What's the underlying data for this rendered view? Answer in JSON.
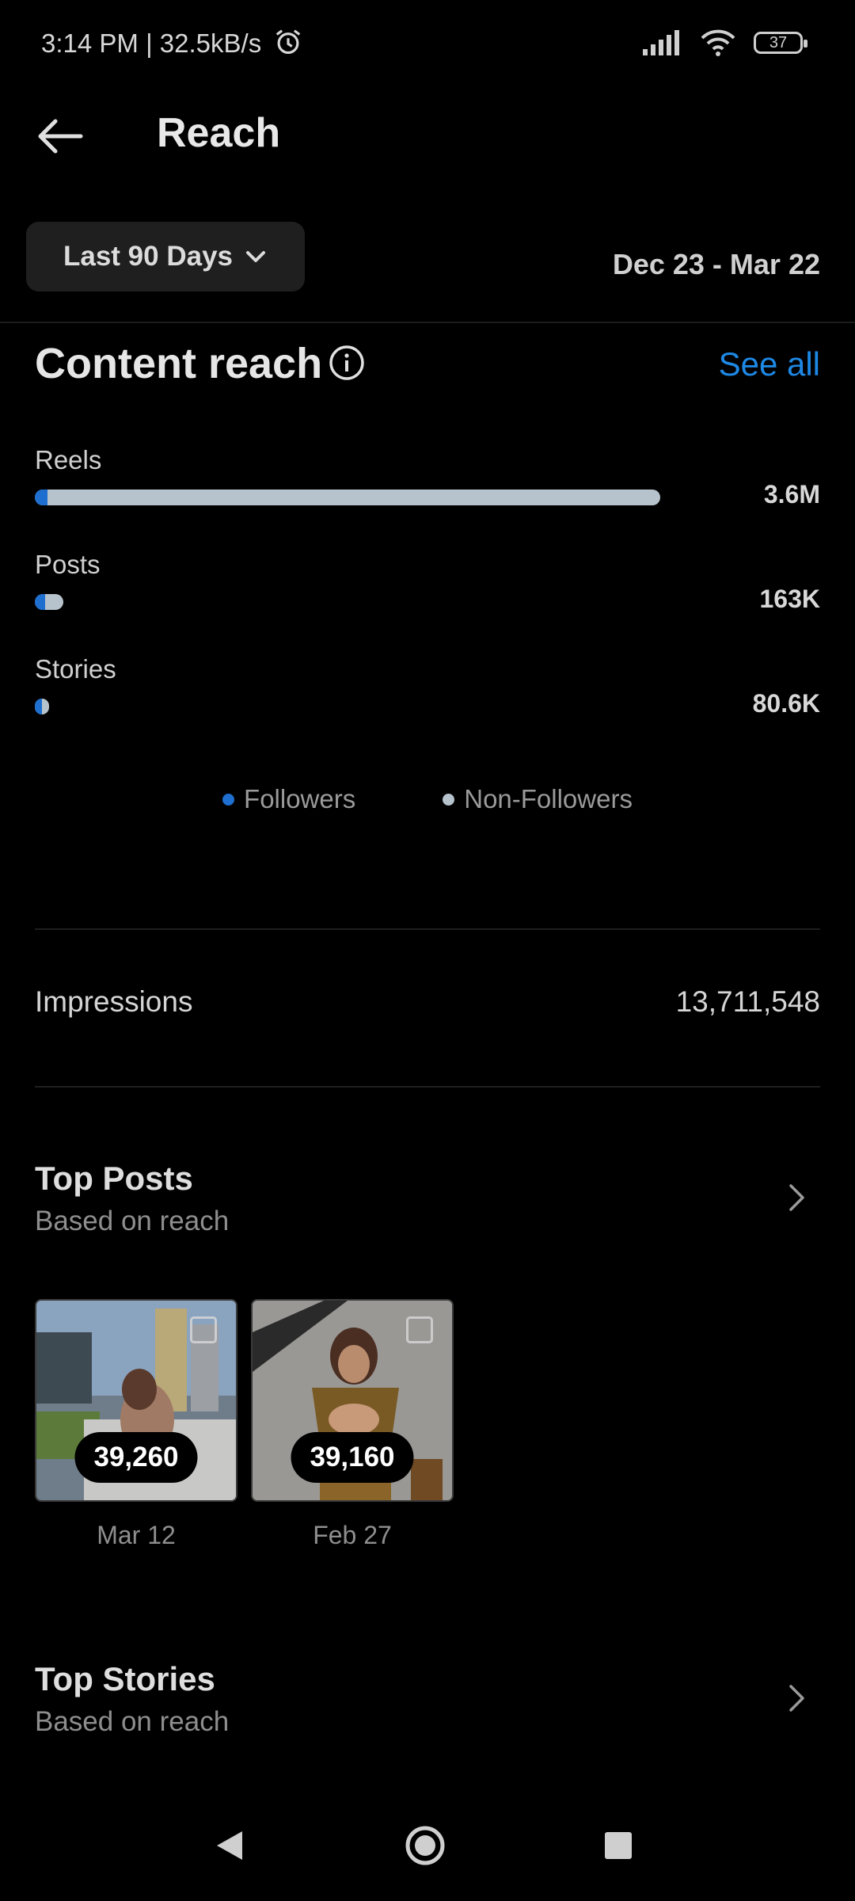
{
  "status_bar": {
    "time_speed": "3:14 PM | 32.5kB/s",
    "battery": "37"
  },
  "header": {
    "title": "Reach"
  },
  "period": {
    "label": "Last 90 Days",
    "date_range": "Dec 23 - Mar 22"
  },
  "content_reach": {
    "title": "Content reach",
    "see_all": "See all",
    "rows": [
      {
        "label": "Reels",
        "value": "3.6M",
        "total_fraction": 0.8,
        "followers_fraction": 0.02
      },
      {
        "label": "Posts",
        "value": "163K",
        "total_fraction": 0.036,
        "followers_fraction": 0.35
      },
      {
        "label": "Stories",
        "value": "80.6K",
        "total_fraction": 0.018,
        "followers_fraction": 0.5
      }
    ],
    "legend": {
      "followers": "Followers",
      "non_followers": "Non-Followers",
      "followers_color": "#1e6fd0",
      "non_followers_color": "#b7c3cc"
    }
  },
  "impressions": {
    "label": "Impressions",
    "value": "13,711,548"
  },
  "top_posts": {
    "title": "Top Posts",
    "subtitle": "Based on reach",
    "items": [
      {
        "count": "39,260",
        "date": "Mar 12"
      },
      {
        "count": "39,160",
        "date": "Feb 27"
      }
    ]
  },
  "top_stories": {
    "title": "Top Stories",
    "subtitle": "Based on reach"
  }
}
